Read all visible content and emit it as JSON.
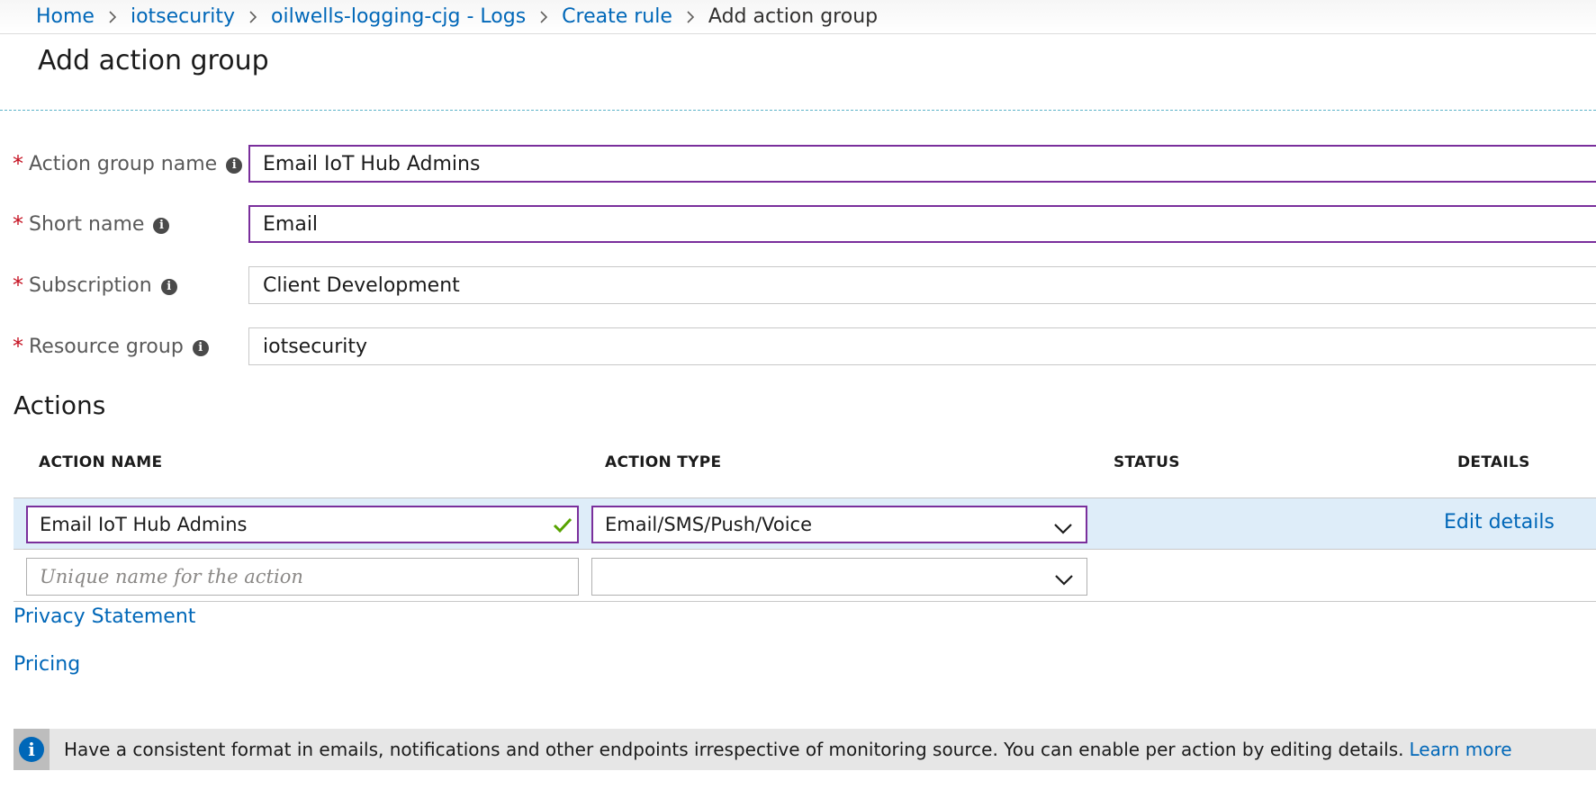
{
  "breadcrumb": {
    "items": [
      {
        "label": "Home"
      },
      {
        "label": "iotsecurity"
      },
      {
        "label": "oilwells-logging-cjg - Logs"
      },
      {
        "label": "Create rule"
      }
    ],
    "current": "Add action group"
  },
  "page": {
    "title": "Add action group"
  },
  "form": {
    "required_marker": "*",
    "action_group_name": {
      "label": "Action group name",
      "value": "Email IoT Hub Admins"
    },
    "short_name": {
      "label": "Short name",
      "value": "Email"
    },
    "subscription": {
      "label": "Subscription",
      "value": "Client Development"
    },
    "resource_group": {
      "label": "Resource group",
      "value": "iotsecurity"
    }
  },
  "actions": {
    "heading": "Actions",
    "columns": {
      "action_name": "ACTION NAME",
      "action_type": "ACTION TYPE",
      "status": "STATUS",
      "details": "DETAILS"
    },
    "rows": [
      {
        "name": "Email IoT Hub Admins",
        "type": "Email/SMS/Push/Voice",
        "status": "",
        "details_link": "Edit details"
      }
    ],
    "new_row": {
      "name_placeholder": "Unique name for the action",
      "type_value": ""
    }
  },
  "links": {
    "privacy": "Privacy Statement",
    "pricing": "Pricing"
  },
  "banner": {
    "text": "Have a consistent format in emails, notifications and other endpoints irrespective of monitoring source. You can enable per action by editing details.",
    "link": "Learn more"
  },
  "icons": {
    "info": "info-icon",
    "check": "checkmark-icon",
    "chevron": "chevron-down-icon",
    "separator": "chevron-right-icon"
  },
  "colors": {
    "link": "#0067b8",
    "focus_border": "#7a2f9c",
    "required": "#c50f1f",
    "selected_row": "#deedf9",
    "valid_check": "#57a300"
  }
}
